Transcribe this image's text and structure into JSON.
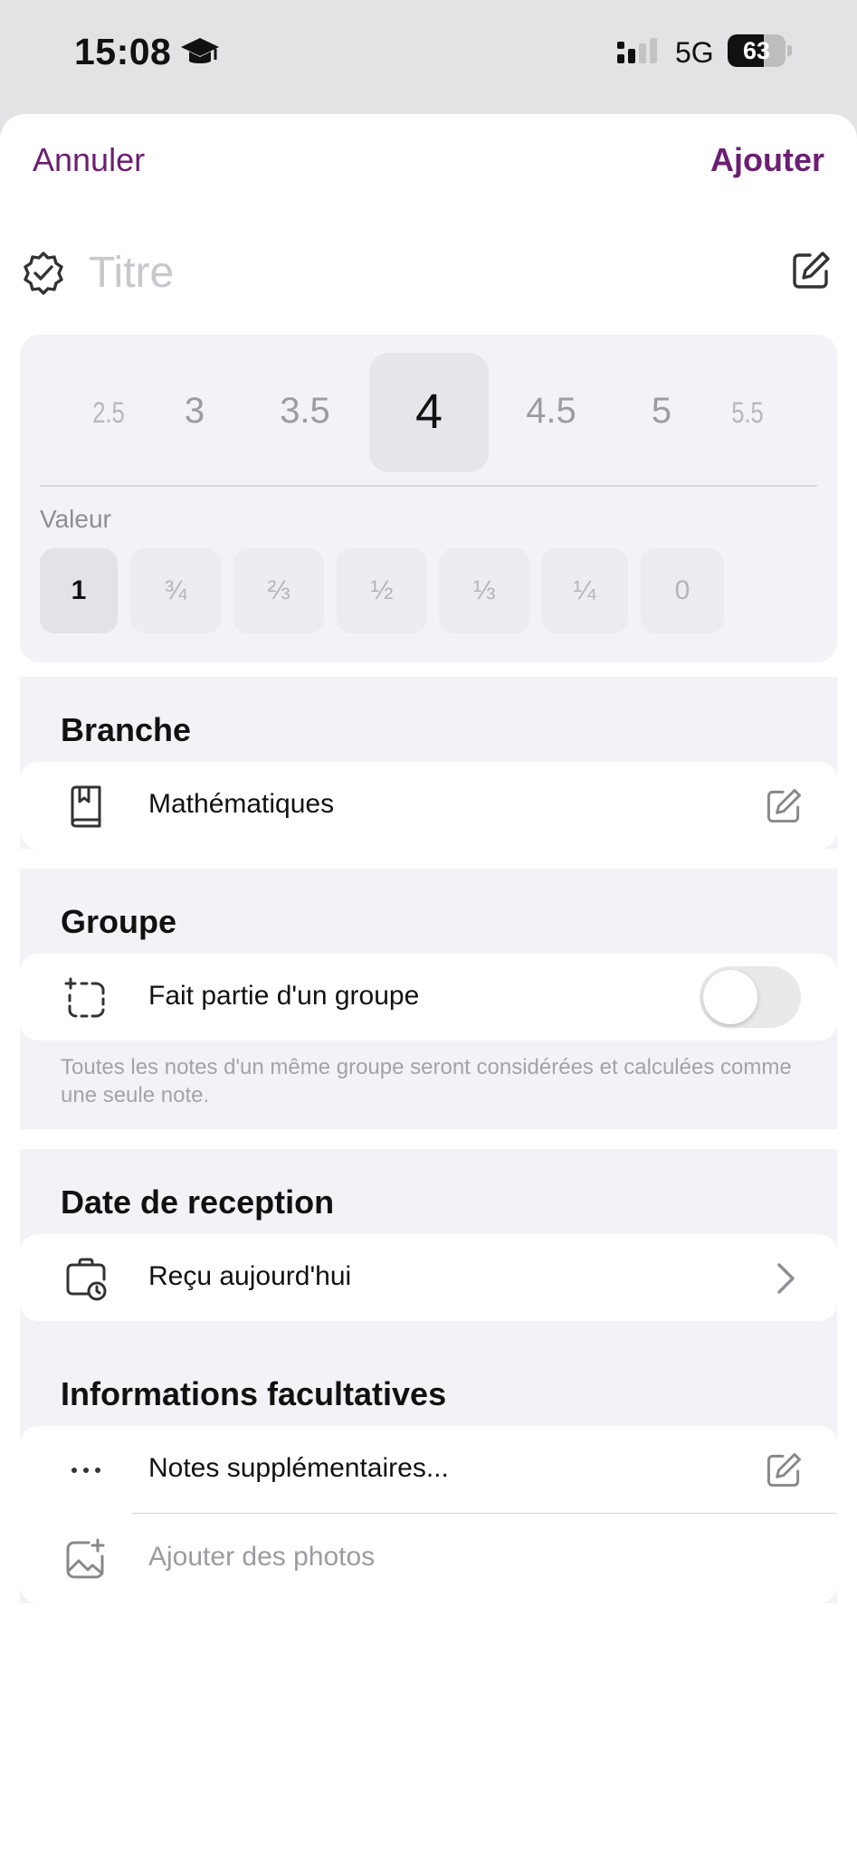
{
  "status_bar": {
    "time": "15:08",
    "network": "5G",
    "battery": "63",
    "battery_level": 0.63
  },
  "nav": {
    "cancel_label": "Annuler",
    "add_label": "Ajouter"
  },
  "title_field": {
    "placeholder": "Titre",
    "value": ""
  },
  "grade": {
    "options": [
      "2.5",
      "3",
      "3.5",
      "4",
      "4.5",
      "5",
      "5.5"
    ],
    "selected": "4",
    "valeur_label": "Valeur",
    "weights": [
      "1",
      "¾",
      "⅔",
      "½",
      "⅓",
      "¼",
      "0"
    ],
    "selected_weight": "1"
  },
  "branche": {
    "title": "Branche",
    "value": "Mathématiques"
  },
  "groupe": {
    "title": "Groupe",
    "toggle_label": "Fait partie d'un groupe",
    "toggle_on": false,
    "footer": "Toutes les notes d'un même groupe seront considérées et calculées comme une seule note."
  },
  "date": {
    "title": "Date de reception",
    "value": "Reçu aujourd'hui"
  },
  "optional": {
    "title": "Informations facultatives",
    "notes_label": "Notes supplémentaires...",
    "photos_label": "Ajouter des photos"
  },
  "colors": {
    "accent": "#6b1f71",
    "group_bg": "#f2f2f7",
    "placeholder": "#c7c7cc"
  },
  "icons": {
    "title": "rosette-check-icon",
    "title_edit": "square-pencil-icon",
    "branche": "book-icon",
    "groupe": "dashed-square-plus-icon",
    "date": "briefcase-clock-icon",
    "notes": "ellipsis-icon",
    "photos": "photo-plus-icon"
  }
}
